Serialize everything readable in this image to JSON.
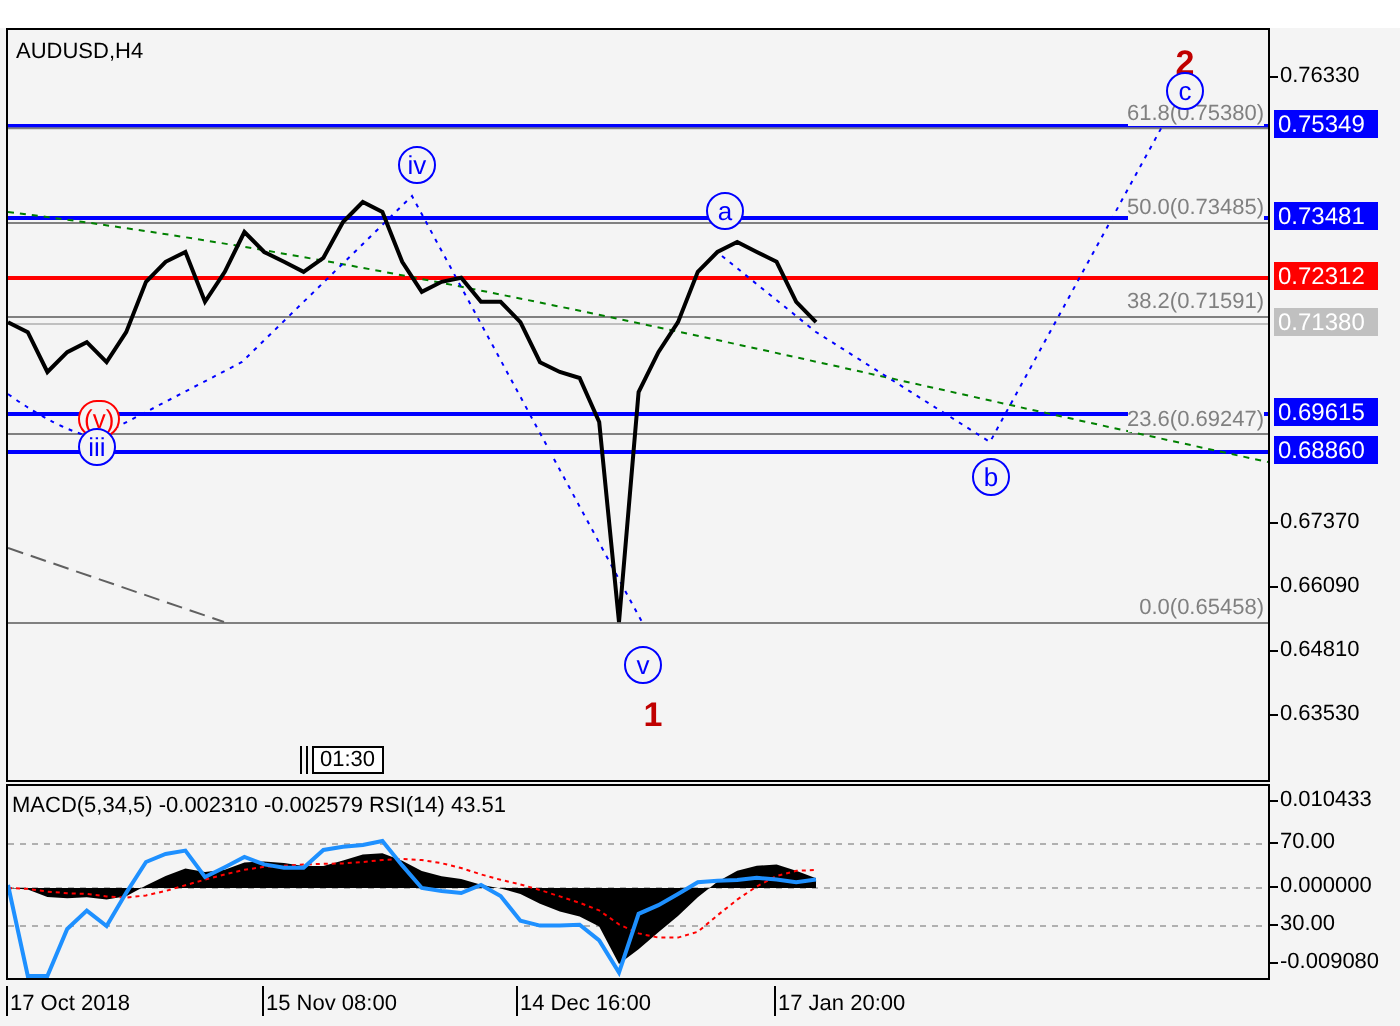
{
  "main_chart": {
    "symbol": "AUDUSD,H4",
    "price_axis": [
      "0.76330",
      "0.67370",
      "0.66090",
      "0.64810",
      "0.63530"
    ],
    "fib_levels": [
      "61.8(0.75380)",
      "50.0(0.73485)",
      "38.2(0.71591)",
      "23.6(0.69247)",
      "0.0(0.65458)"
    ],
    "price_badges": [
      {
        "text": "0.75349",
        "color": "#0000ff"
      },
      {
        "text": "0.73481",
        "color": "#0000ff"
      },
      {
        "text": "0.72312",
        "color": "#ff0000"
      },
      {
        "text": "0.71380",
        "color": "#c0c0c0"
      },
      {
        "text": "0.69615",
        "color": "#0000ff"
      },
      {
        "text": "0.68860",
        "color": "#0000ff"
      }
    ],
    "wave_labels": [
      {
        "text": "2",
        "kind": "plain",
        "color": "#c00000"
      },
      {
        "text": "c",
        "kind": "circled",
        "color": "#0000ff"
      },
      {
        "text": "iv",
        "kind": "circled",
        "color": "#0000ff"
      },
      {
        "text": "a",
        "kind": "circled",
        "color": "#0000ff"
      },
      {
        "text": "(v)",
        "kind": "circled",
        "color": "#ff0000"
      },
      {
        "text": "iii",
        "kind": "circled",
        "color": "#0000ff"
      },
      {
        "text": "b",
        "kind": "circled",
        "color": "#0000ff"
      },
      {
        "text": "v",
        "kind": "circled",
        "color": "#0000ff"
      },
      {
        "text": "1",
        "kind": "plain",
        "color": "#c00000"
      }
    ],
    "time_marker": "01:30"
  },
  "indicator": {
    "label": "MACD(5,34,5) -0.002310 -0.002579 RSI(14) 43.51",
    "axis": [
      "0.010433",
      "70.00",
      "0.000000",
      "30.00",
      "-0.009080"
    ]
  },
  "time_axis": [
    "17 Oct 2018",
    "15 Nov 08:00",
    "14 Dec 16:00",
    "17 Jan 20:00"
  ]
}
